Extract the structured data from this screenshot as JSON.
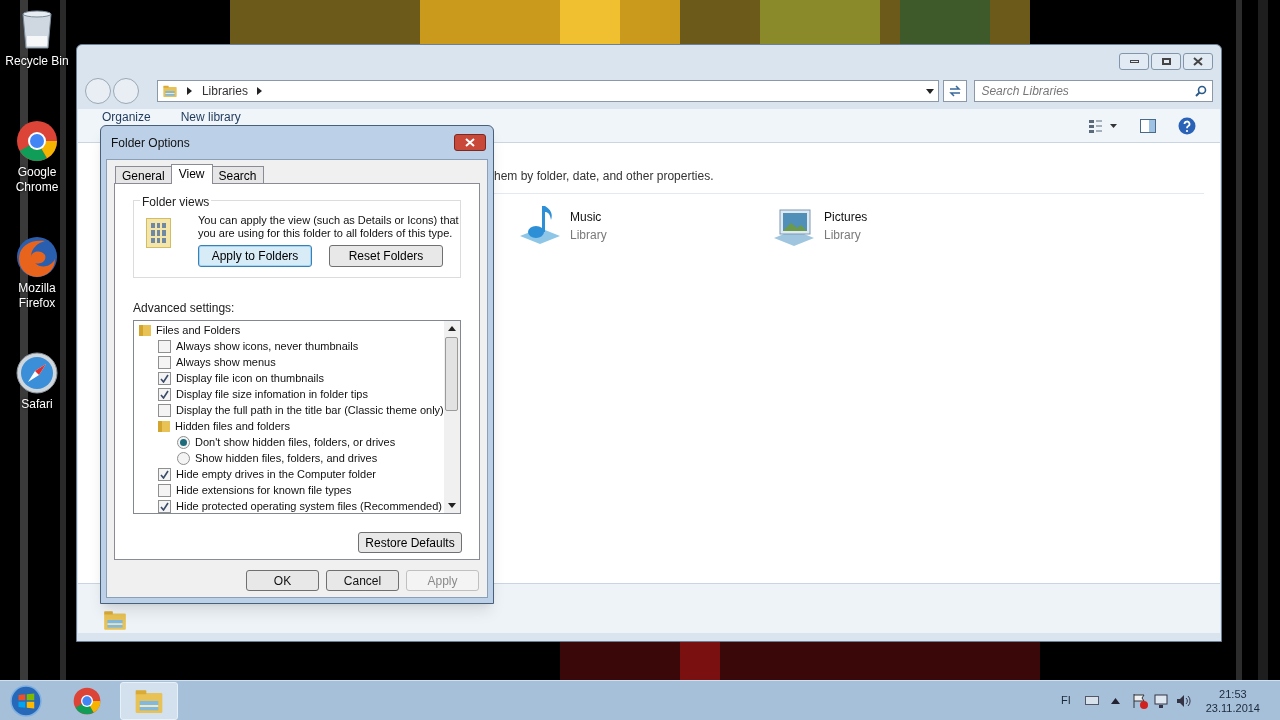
{
  "desktop_icons": [
    {
      "kind": "recycle",
      "label": "Recycle Bin"
    },
    {
      "kind": "chrome",
      "label": "Google Chrome"
    },
    {
      "kind": "firefox",
      "label": "Mozilla Firefox"
    },
    {
      "kind": "safari",
      "label": "Safari"
    }
  ],
  "explorer": {
    "breadcrumbs": [
      "Libraries"
    ],
    "search_placeholder": "Search Libraries",
    "toolbar": [
      "Organize",
      "New library"
    ],
    "description": "hem by folder, date, and other properties.",
    "libraries": [
      {
        "kind": "music",
        "name": "Music",
        "subtitle": "Library"
      },
      {
        "kind": "pictures",
        "name": "Pictures",
        "subtitle": "Library"
      }
    ]
  },
  "dialog": {
    "title": "Folder Options",
    "tabs": [
      {
        "label": "General",
        "selected": false
      },
      {
        "label": "View",
        "selected": true
      },
      {
        "label": "Search",
        "selected": false
      }
    ],
    "folder_views": {
      "title": "Folder views",
      "text": "You can apply the view (such as Details or Icons) that you are using for this folder to all folders of this type.",
      "buttons": [
        {
          "label": "Apply to Folders",
          "focused": true
        },
        {
          "label": "Reset Folders",
          "focused": false
        }
      ]
    },
    "advanced_label": "Advanced settings:",
    "advanced": [
      {
        "kind": "folder",
        "label": "Files and Folders",
        "children": [
          {
            "kind": "checkbox",
            "label": "Always show icons, never thumbnails",
            "checked": false
          },
          {
            "kind": "checkbox",
            "label": "Always show menus",
            "checked": false
          },
          {
            "kind": "checkbox",
            "label": "Display file icon on thumbnails",
            "checked": true
          },
          {
            "kind": "checkbox",
            "label": "Display file size infomation in folder tips",
            "checked": true
          },
          {
            "kind": "checkbox",
            "label": "Display the full path in the title bar (Classic theme only)",
            "checked": false
          },
          {
            "kind": "folder",
            "label": "Hidden files and folders",
            "children": [
              {
                "kind": "radio",
                "label": "Don't show hidden files, folders, or drives",
                "selected": true
              },
              {
                "kind": "radio",
                "label": "Show hidden files, folders, and drives",
                "selected": false
              }
            ]
          },
          {
            "kind": "checkbox",
            "label": "Hide empty drives in the Computer folder",
            "checked": true
          },
          {
            "kind": "checkbox",
            "label": "Hide extensions for known file types",
            "checked": false
          },
          {
            "kind": "checkbox",
            "label": "Hide protected operating system files (Recommended)",
            "checked": true
          }
        ]
      }
    ],
    "restore_button": "Restore Defaults",
    "buttons": [
      {
        "label": "OK",
        "disabled": false
      },
      {
        "label": "Cancel",
        "disabled": false
      },
      {
        "label": "Apply",
        "disabled": true
      }
    ]
  },
  "taskbar": {
    "apps": [
      {
        "kind": "chrome",
        "active": false
      },
      {
        "kind": "explorer",
        "active": true
      }
    ],
    "language": "FI",
    "time": "21:53",
    "date": "23.11.2014"
  }
}
